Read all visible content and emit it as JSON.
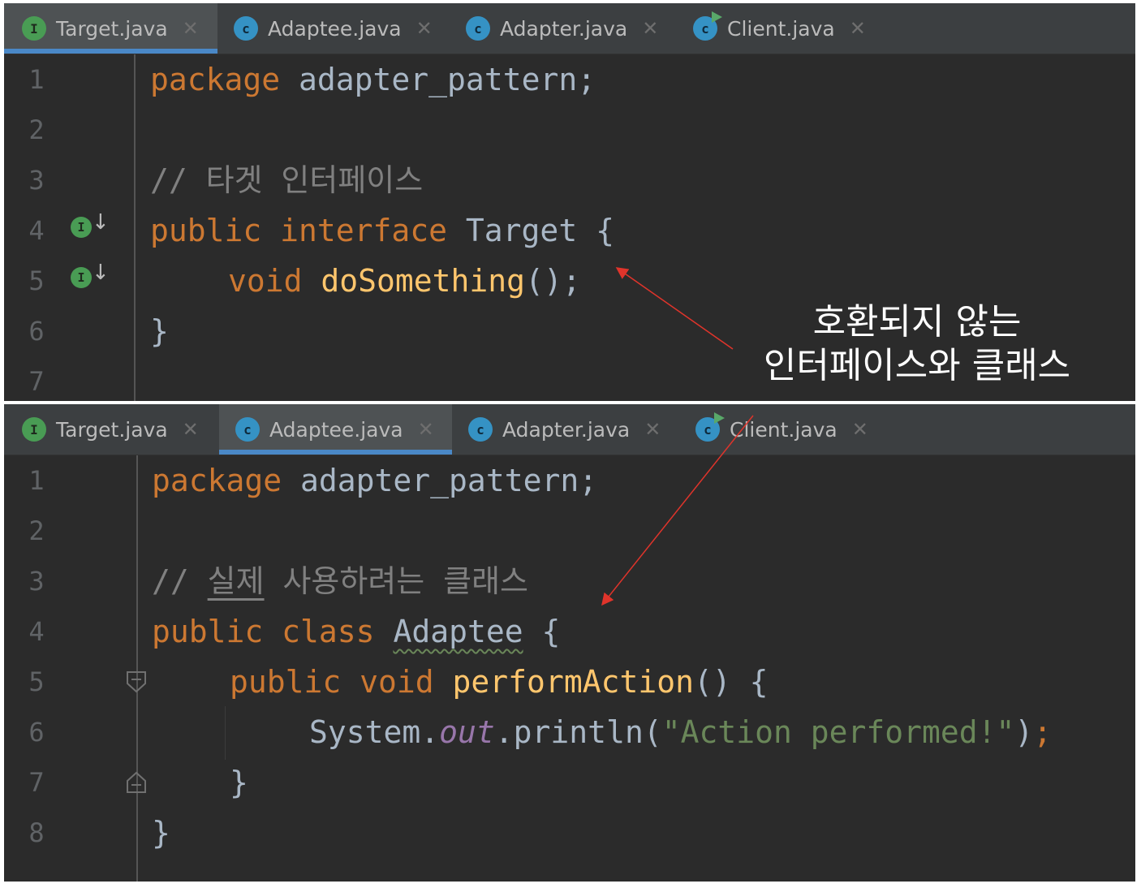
{
  "top_panel": {
    "tabs": [
      {
        "label": "Target.java",
        "icon": "interface-icon",
        "active": true
      },
      {
        "label": "Adaptee.java",
        "icon": "class-icon",
        "active": false
      },
      {
        "label": "Adapter.java",
        "icon": "class-icon",
        "active": false
      },
      {
        "label": "Client.java",
        "icon": "runnable-class-icon",
        "active": false
      }
    ],
    "line_numbers": [
      "1",
      "2",
      "3",
      "4",
      "5",
      "6",
      "7"
    ],
    "code": {
      "l1_kw": "package",
      "l1_rest": " adapter_pattern;",
      "l3_comment": "// 타겟 인터페이스",
      "l4_kw": "public interface",
      "l4_name": " Target {",
      "l5_kw": "void",
      "l5_fn": " doSomething",
      "l5_rest": "();",
      "l6": "}"
    }
  },
  "bottom_panel": {
    "tabs": [
      {
        "label": "Target.java",
        "icon": "interface-icon",
        "active": false
      },
      {
        "label": "Adaptee.java",
        "icon": "class-icon",
        "active": true
      },
      {
        "label": "Adapter.java",
        "icon": "class-icon",
        "active": false
      },
      {
        "label": "Client.java",
        "icon": "runnable-class-icon",
        "active": false
      }
    ],
    "line_numbers": [
      "1",
      "2",
      "3",
      "4",
      "5",
      "6",
      "7",
      "8"
    ],
    "code": {
      "l1_kw": "package",
      "l1_rest": " adapter_pattern;",
      "l3_slashes": "// ",
      "l3_word1": "실제",
      "l3_rest": " 사용하려는 클래스",
      "l4_kw": "public class",
      "l4_name": "Adaptee",
      "l4_brace": " {",
      "l5_kw": "public void",
      "l5_fn": " performAction",
      "l5_rest": "() {",
      "l6_sys": "System.",
      "l6_out": "out",
      "l6_println": ".println(",
      "l6_str": "\"Action performed!\"",
      "l6_close": ")",
      "l6_semi": ";",
      "l7": "}",
      "l8": "}"
    }
  },
  "annotation": {
    "line1": "호환되지 않는",
    "line2": "인터페이스와 클래스",
    "arrow_color": "#e0342b"
  },
  "colors": {
    "editor_bg": "#2b2b2b",
    "keyword": "#cc7832",
    "function": "#ffc66d",
    "comment": "#808080",
    "string": "#6a8759",
    "static_field": "#9876aa",
    "default_text": "#a9b7c6",
    "active_tab_underline": "#4a88c7"
  }
}
